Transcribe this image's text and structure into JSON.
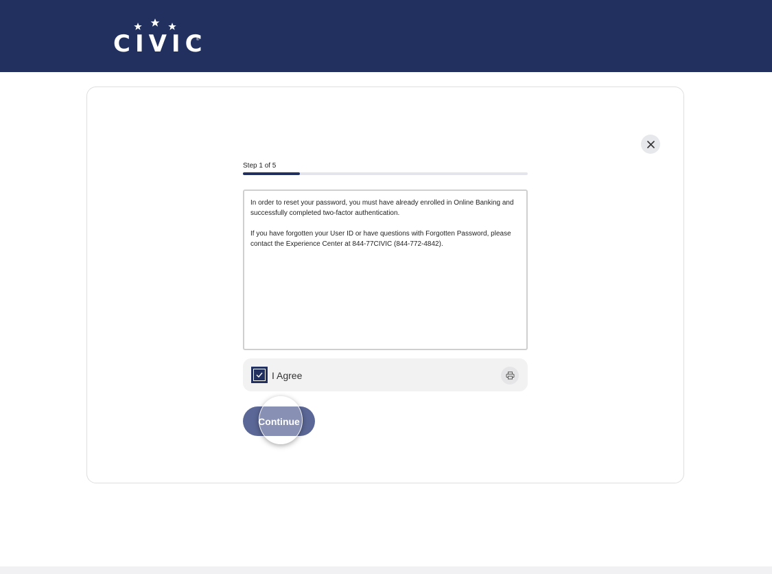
{
  "brand": {
    "name": "CIVIC",
    "registered_mark": "®",
    "primary_color": "#21305f",
    "button_color": "#5b6796"
  },
  "wizard": {
    "step_label": "Step 1 of 5",
    "progress": 0.2
  },
  "terms": {
    "paragraph_1": "In order to reset your password, you must have already enrolled in Online Banking and successfully completed two-factor authentication.",
    "paragraph_2": "If you have forgotten your User ID or have questions with Forgotten Password, please contact the Experience Center at 844-77CIVIC (844-772-4842)."
  },
  "agreement": {
    "label": "I Agree",
    "checked": true
  },
  "actions": {
    "continue_label": "Continue",
    "close_icon": "close-icon",
    "print_icon": "print-icon"
  }
}
